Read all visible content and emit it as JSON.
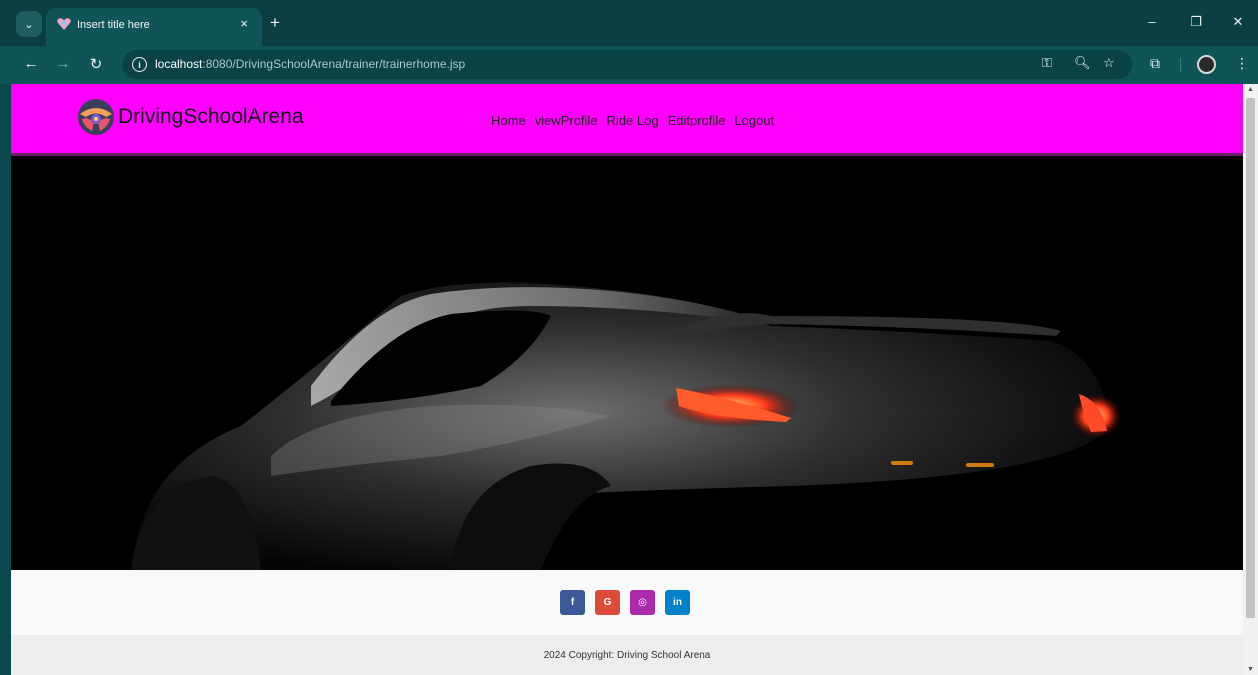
{
  "browser": {
    "tab_title": "Insert title here",
    "tab_close": "×",
    "new_tab": "+",
    "url_host": "localhost",
    "url_path": ":8080/DrivingSchoolArena/trainer/trainerhome.jsp",
    "icons": [
      "tab-search-icon",
      "favicon-icon",
      "close-icon",
      "plus-icon",
      "back-arrow-icon",
      "forward-arrow-icon",
      "reload-icon",
      "info-icon",
      "key-icon",
      "zoom-icon",
      "star-icon",
      "extensions-icon",
      "profile-icon",
      "menu-dots-icon",
      "minimize-icon",
      "restore-icon",
      "window-close-icon"
    ]
  },
  "site": {
    "brand": "DrivingSchoolArena",
    "menu": [
      "Home",
      "viewProfile",
      "Ride Log",
      "Editprofile",
      "Logout"
    ],
    "nav_color": "#ff00ff",
    "socials": [
      {
        "label": "f",
        "color": "#3b5998"
      },
      {
        "label": "G",
        "color": "#dd4b39"
      },
      {
        "label": "◎",
        "color": "#ac2bac"
      },
      {
        "label": "in",
        "color": "#0082ca"
      }
    ],
    "copyright": "2024 Copyright: Driving School Arena"
  }
}
